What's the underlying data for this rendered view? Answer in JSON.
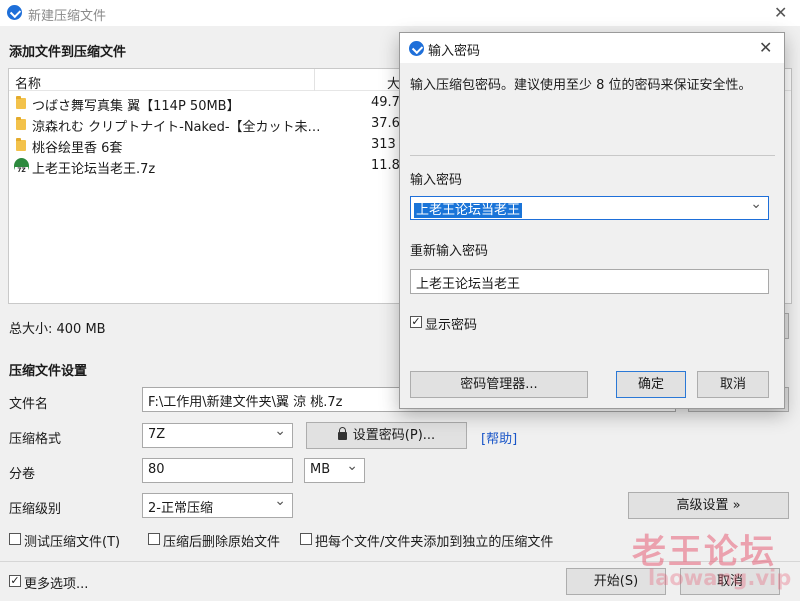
{
  "window": {
    "title": "新建压缩文件",
    "close_glyph": "✕"
  },
  "add_section": {
    "title": "添加文件到压缩文件"
  },
  "file_list": {
    "columns": {
      "name": "名称",
      "size": "大"
    },
    "rows": [
      {
        "name": "つばさ舞写真集 翼【114P 50MB】",
        "size": "49.7 M",
        "icon": "folder-icon"
      },
      {
        "name": "涼森れむ クリプトナイト-Naked-【全カット未…",
        "size": "37.6 M",
        "icon": "folder-icon"
      },
      {
        "name": "桃谷绘里香 6套",
        "size": "313 M",
        "icon": "folder-icon"
      },
      {
        "name": "上老王论坛当老王.7z",
        "size": "11.8 M",
        "icon": "archive-7z-icon"
      }
    ]
  },
  "total_size": "总大小: 400 MB",
  "settings": {
    "title": "压缩文件设置",
    "filename_label": "文件名",
    "filename_value": "F:\\工作用\\新建文件夹\\翼 涼 桃.7z",
    "format_label": "压缩格式",
    "format_value": "7Z",
    "set_password_label": "设置密码(P)...",
    "help_link": "[帮助]",
    "split_label": "分卷",
    "split_value": "80",
    "split_unit": "MB",
    "level_label": "压缩级别",
    "level_value": "2-正常压缩",
    "advanced_label": "高级设置 »",
    "test_label": "测试压缩文件(T)",
    "delete_label": "压缩后删除原始文件",
    "separate_label": "把每个文件/文件夹添加到独立的压缩文件",
    "more_options_label": "更多选项...",
    "more_options_checked": true,
    "start_label": "开始(S)",
    "cancel_label": "取消"
  },
  "watermark": {
    "text": "老王论坛",
    "url": "laowang.vip"
  },
  "dialog": {
    "title": "输入密码",
    "close_glyph": "✕",
    "description": "输入压缩包密码。建议使用至少 8 位的密码来保证安全性。",
    "password_label": "输入密码",
    "password_value": "上老王论坛当老王",
    "confirm_label": "重新输入密码",
    "confirm_value": "上老王论坛当老王",
    "show_password_label": "显示密码",
    "show_password_checked": true,
    "manager_label": "密码管理器...",
    "ok_label": "确定",
    "cancel_label": "取消"
  },
  "colors": {
    "accent": "#1e6fd9",
    "selection": "#1a74d8",
    "link": "#1a56c8",
    "watermark": "#e86078"
  }
}
